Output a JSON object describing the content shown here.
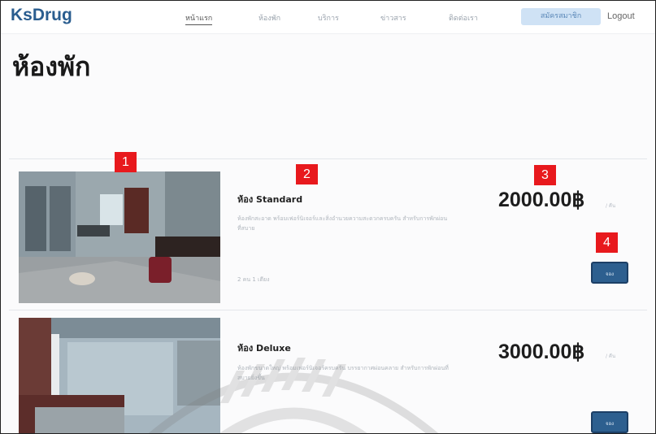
{
  "navbar": {
    "brand": "KsDrug",
    "items": [
      "หน้าแรก",
      "ห้องพัก",
      "บริการ",
      "ข่าวสาร",
      "ติดต่อเรา"
    ],
    "register_label": "สมัครสมาชิก",
    "logout_label": "Logout"
  },
  "page_title": "ห้องพัก",
  "rooms": [
    {
      "name": "ห้อง Standard",
      "desc": "ห้องพักสะอาด พร้อมเฟอร์นิเจอร์และสิ่งอำนวยความสะดวกครบครัน สำหรับการพักผ่อนที่สบาย",
      "meta": "2 คน   1 เตียง",
      "price": "2000.00฿",
      "per": "/ คืน",
      "book_label": "จอง"
    },
    {
      "name": "ห้อง Deluxe",
      "desc": "ห้องพักขนาดใหญ่ พร้อมเฟอร์นิเจอร์ครบครัน บรรยากาศผ่อนคลาย สำหรับการพักผ่อนที่สบายยิ่งขึ้น",
      "meta": "",
      "price": "3000.00฿",
      "per": "/ คืน",
      "book_label": "จอง"
    }
  ],
  "markers": [
    "1",
    "2",
    "3",
    "4"
  ],
  "colors": {
    "brand": "#2a5d8f",
    "button": "#2d5f8f",
    "marker": "#e8191d"
  }
}
